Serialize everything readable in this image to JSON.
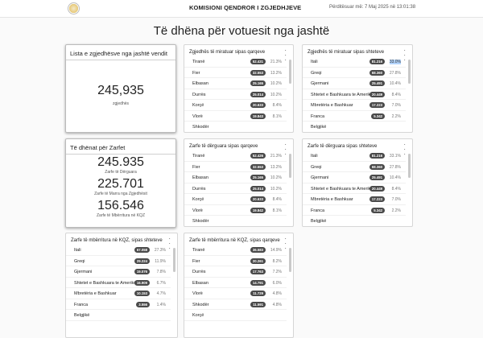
{
  "header": {
    "title": "KOMISIONI QENDROR I ZGJEDHJEVE",
    "updated": "Përditësuar më: 7 Maj 2025 në 13:01:38"
  },
  "page_title": "Të dhëna për votuesit nga jashtë",
  "card_list": {
    "title": "Lista e zgjedhësve nga jashtë vendit",
    "value": "245,935",
    "caption": "zgjedhës"
  },
  "card_regjistruar_qarqe": {
    "title": "Zgjedhës të miratuar sipas qarqeve",
    "rows": [
      {
        "name": "Tiranë",
        "count": "52.431",
        "pct": "21.3%"
      },
      {
        "name": "Fier",
        "count": "32.553",
        "pct": "13.2%"
      },
      {
        "name": "Elbasan",
        "count": "25.165",
        "pct": "10.2%"
      },
      {
        "name": "Durrës",
        "count": "25.014",
        "pct": "10.2%"
      },
      {
        "name": "Korçë",
        "count": "20.633",
        "pct": "8.4%"
      },
      {
        "name": "Vlorë",
        "count": "19.843",
        "pct": "8.1%"
      },
      {
        "name": "Shkodër",
        "count": "",
        "pct": ""
      }
    ]
  },
  "card_regjistruar_shtete": {
    "title": "Zgjedhës të miratuar sipas shteteve",
    "rows": [
      {
        "name": "Itali",
        "count": "81.216",
        "pct": "33.0%"
      },
      {
        "name": "Greqi",
        "count": "68.360",
        "pct": "27.8%"
      },
      {
        "name": "Gjermani",
        "count": "25.491",
        "pct": "10.4%"
      },
      {
        "name": "Shtetet e Bashkuara te Amerikës",
        "count": "20.449",
        "pct": "8.4%"
      },
      {
        "name": "Mbretëria e Bashkuar",
        "count": "17.223",
        "pct": "7.0%"
      },
      {
        "name": "Franca",
        "count": "5.342",
        "pct": "2.2%"
      },
      {
        "name": "Belgjikë",
        "count": "",
        "pct": ""
      }
    ]
  },
  "card_zarfet": {
    "title": "Të dhënat për Zarfet",
    "stats": [
      {
        "value": "245.935",
        "caption": "Zarfe të Dërguara"
      },
      {
        "value": "225.701",
        "caption": "Zarfe të Marra nga Zgjedhësit"
      },
      {
        "value": "156.546",
        "caption": "Zarfe të Mbërritura në KQZ"
      }
    ]
  },
  "card_derguara_qarqe": {
    "title": "Zarfe të dërguara sipas qarqeve",
    "rows": [
      {
        "name": "Tiranë",
        "count": "52.426",
        "pct": "21.3%"
      },
      {
        "name": "Fier",
        "count": "32.553",
        "pct": "13.2%"
      },
      {
        "name": "Elbasan",
        "count": "25.165",
        "pct": "10.2%"
      },
      {
        "name": "Durrës",
        "count": "25.014",
        "pct": "10.2%"
      },
      {
        "name": "Korçë",
        "count": "20.633",
        "pct": "8.4%"
      },
      {
        "name": "Vlorë",
        "count": "19.842",
        "pct": "8.1%"
      },
      {
        "name": "Shkodër",
        "count": "",
        "pct": ""
      }
    ]
  },
  "card_derguara_shtete": {
    "title": "Zarfe të dërguara sipas shteteve",
    "rows": [
      {
        "name": "Itali",
        "count": "81.216",
        "pct": "33.1%"
      },
      {
        "name": "Greqi",
        "count": "68.360",
        "pct": "27.8%"
      },
      {
        "name": "Gjermani",
        "count": "25.491",
        "pct": "10.4%"
      },
      {
        "name": "Shtetet e Bashkuara te Amerikës",
        "count": "20.449",
        "pct": "8.4%"
      },
      {
        "name": "Mbretëria e Bashkuar",
        "count": "17.223",
        "pct": "7.0%"
      },
      {
        "name": "Franca",
        "count": "5.342",
        "pct": "2.2%"
      },
      {
        "name": "Belgjikë",
        "count": "",
        "pct": ""
      }
    ]
  },
  "card_mberritura_shtete": {
    "title": "Zarfe të mbërritura në KQZ, sipas shteteve",
    "rows": [
      {
        "name": "Itali",
        "count": "67.058",
        "pct": "27.3%"
      },
      {
        "name": "Greqi",
        "count": "29.224",
        "pct": "11.9%"
      },
      {
        "name": "Gjermani",
        "count": "19.076",
        "pct": "7.8%"
      },
      {
        "name": "Shtetet e Bashkuara te Amerikës",
        "count": "16.909",
        "pct": "6.7%"
      },
      {
        "name": "Mbretëria e Bashkuar",
        "count": "10.153",
        "pct": "4.7%"
      },
      {
        "name": "Franca",
        "count": "3.556",
        "pct": "1.4%"
      },
      {
        "name": "Belgjikë",
        "count": "",
        "pct": ""
      }
    ]
  },
  "card_mberritura_qarqe": {
    "title": "Zarfe të mbërritura në KQZ, sipas qarqeve",
    "rows": [
      {
        "name": "Tiranë",
        "count": "36.583",
        "pct": "14.9%"
      },
      {
        "name": "Fier",
        "count": "20.261",
        "pct": "8.2%"
      },
      {
        "name": "Durrës",
        "count": "17.763",
        "pct": "7.2%"
      },
      {
        "name": "Elbasan",
        "count": "14.791",
        "pct": "6.0%"
      },
      {
        "name": "Vlorë",
        "count": "11.729",
        "pct": "4.8%"
      },
      {
        "name": "Shkodër",
        "count": "11.591",
        "pct": "4.8%"
      },
      {
        "name": "Korçë",
        "count": "",
        "pct": ""
      }
    ]
  },
  "colors": {
    "badge": "#4a4a4a",
    "highlight": "#b3d4fc"
  },
  "icons": {
    "menu": "more-vertical-icon",
    "logo": "kqz-seal-logo"
  }
}
